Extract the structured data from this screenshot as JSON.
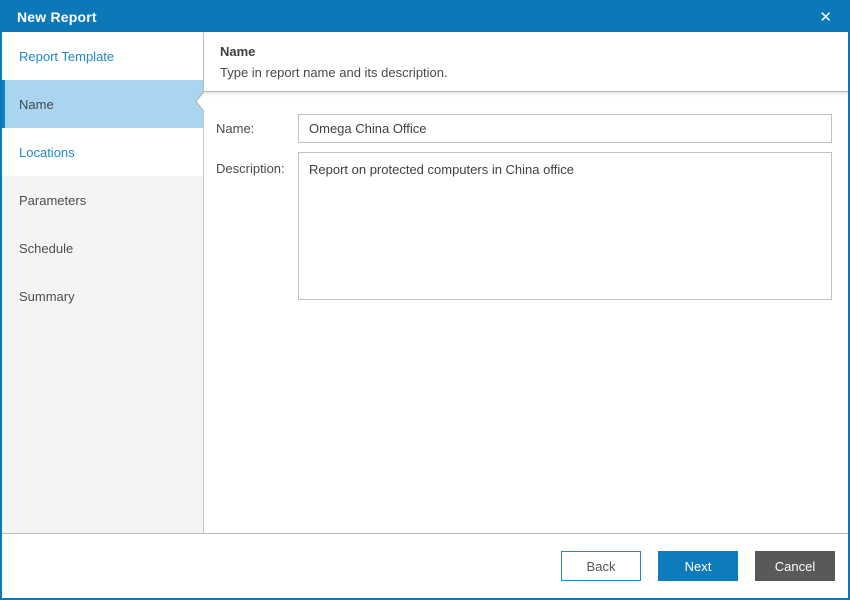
{
  "window": {
    "title": "New Report",
    "close_glyph": "✕"
  },
  "sidebar": {
    "items": [
      {
        "label": "Report Template",
        "state": "completed"
      },
      {
        "label": "Name",
        "state": "active"
      },
      {
        "label": "Locations",
        "state": "completed"
      },
      {
        "label": "Parameters",
        "state": "upcoming"
      },
      {
        "label": "Schedule",
        "state": "upcoming"
      },
      {
        "label": "Summary",
        "state": "upcoming"
      }
    ]
  },
  "content": {
    "heading": "Name",
    "subtitle": "Type in report name and its description.",
    "fields": {
      "name": {
        "label": "Name:",
        "value": "Omega China Office"
      },
      "description": {
        "label": "Description:",
        "value": "Report on protected computers in China office"
      }
    }
  },
  "footer": {
    "back_label": "Back",
    "next_label": "Next",
    "cancel_label": "Cancel"
  },
  "colors": {
    "titlebar_blue": "#0b79b8",
    "accent_stripe_blue": "#1182c2",
    "active_step_bg": "#a9d5f1",
    "link_blue": "#2289cb",
    "next_button_blue": "#0e7cbc",
    "cancel_button_gray": "#595959"
  }
}
